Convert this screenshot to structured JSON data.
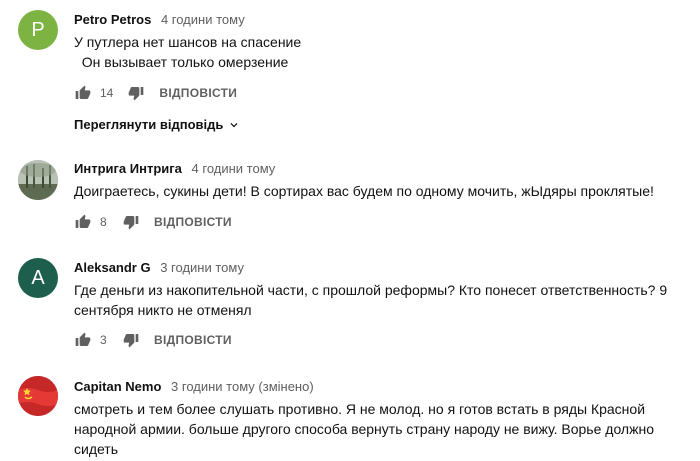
{
  "comments": [
    {
      "author": "Petro Petros",
      "time": "4 години тому",
      "avatar_letter": "P",
      "lines": [
        "У путлера нет шансов на спасение",
        "  Он вызывает только омерзение"
      ],
      "likes": "14",
      "reply_label": "ВІДПОВІСТИ",
      "view_replies": "Переглянути відповідь"
    },
    {
      "author": "Интрига Интрига",
      "time": "4 години тому",
      "lines": [
        "Доиграетесь, сукины дети! В сортирах вас будем по одному мочить, жЫдяры проклятые!"
      ],
      "likes": "8",
      "reply_label": "ВІДПОВІСТИ"
    },
    {
      "author": "Aleksandr G",
      "time": "3 години тому",
      "avatar_letter": "A",
      "lines": [
        "Где деньги из накопительной части, с прошлой реформы? Кто понесет ответственность? 9",
        "сентября никто не отменял"
      ],
      "likes": "3",
      "reply_label": "ВІДПОВІСТИ"
    },
    {
      "author": "Capitan Nemo",
      "time": "3 години тому (змінено)",
      "lines": [
        "смотреть и тем более слушать противно. Я не молод. но я готов встать в ряды Красной",
        "народной армии. больше другого способа вернуть страну народу не вижу. Ворье должно",
        "сидеть"
      ]
    }
  ],
  "colors": {
    "avatar_p": "#7cb342",
    "avatar_a": "#1e5e4c",
    "flag_red": "#d32f2f",
    "meta_gray": "#606060"
  },
  "icons": [
    "thumb-up-icon",
    "thumb-down-icon",
    "chevron-down-icon"
  ]
}
